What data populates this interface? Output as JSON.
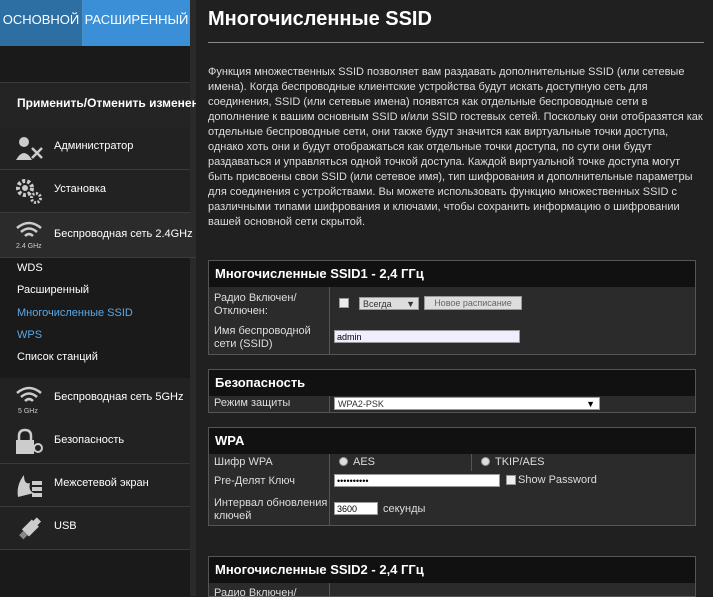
{
  "tabs": {
    "basic": "ОСНОВНОЙ",
    "advanced": "РАСШИРЕННЫЙ"
  },
  "apply_label": "Применить/Отменить изменения",
  "menu": [
    {
      "label": "Администратор",
      "icon": "admin-icon"
    },
    {
      "label": "Установка",
      "icon": "gear-icon"
    },
    {
      "label": "Беспроводная сеть 2.4GHz",
      "icon": "wifi-icon",
      "badge": "2.4 GHz"
    },
    {
      "label": "Беспроводная сеть 5GHz",
      "icon": "wifi-icon",
      "badge": "5 GHz"
    },
    {
      "label": "Безопасность",
      "icon": "lock-icon"
    },
    {
      "label": "Межсетевой экран",
      "icon": "firewall-icon"
    },
    {
      "label": "USB",
      "icon": "usb-icon"
    }
  ],
  "submenu": [
    "WDS",
    "Расширенный",
    "Многочисленные SSID",
    "WPS",
    "Список станций"
  ],
  "page_title": "Многочисленные SSID",
  "description": "Функция множественных SSID позволяет вам раздавать дополнительные SSID (или сетевые имена). Когда беспроводные клиентские устройства будут искать доступную сеть для соединения, SSID (или сетевые имена) появятся как отдельные беспроводные сети в дополнение к вашим основным SSID и/или SSID гостевых сетей. Поскольку они отобразятся как отдельные беспроводные сети, они также будут значится как виртуальные точки доступа, однако хоть они и будут отображаться как отдельные точки доступа, по сути они будут раздаваться и управляться одной точкой доступа. Каждой виртуальной точке доступа могут быть присвоены свои SSID (или сетевое имя), тип шифрования и дополнительные параметры для соединения с устройствами. Вы можете использовать функцию множественных SSID с различными типами шифрования и ключами, чтобы сохранить информацию о шифровании вашей основной сети скрытой.",
  "ssid1": {
    "title": "Многочисленные SSID1 - 2,4 ГГц",
    "radio_label": "Радио Включен/ Отключен:",
    "schedule_value": "Всегда",
    "new_schedule": "Новое расписание",
    "ssid_label": "Имя беспроводной сети (SSID)",
    "ssid_value": "admin"
  },
  "security": {
    "title": "Безопасность",
    "mode_label": "Режим защиты",
    "mode_value": "WPA2-PSK"
  },
  "wpa": {
    "title": "WPA",
    "cipher_label": "Шифр WPA",
    "aes": "AES",
    "tkip": "TKIP/AES",
    "key_label": "Pre-Делят Ключ",
    "key_value": "••••••••••",
    "show_password": "Show Password",
    "interval_label": "Интервал обновления ключей",
    "interval_value": "3600",
    "seconds": "секунды"
  },
  "ssid2": {
    "title": "Многочисленные SSID2 - 2,4 ГГц",
    "radio_label": "Радио Включен/"
  },
  "colors": {
    "accent": "#3a8fd6",
    "link": "#5aa8e8"
  }
}
